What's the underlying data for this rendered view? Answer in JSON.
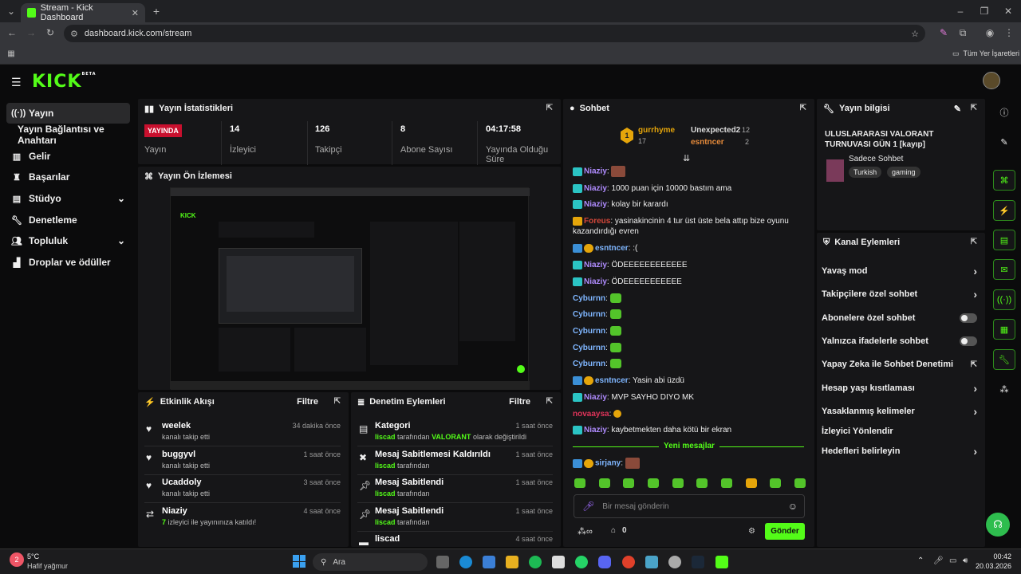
{
  "browser": {
    "tab_title": "Stream - Kick Dashboard",
    "url": "dashboard.kick.com/stream",
    "bookmarks_label": "Tüm Yer İşaretleri"
  },
  "app": {
    "logo": "KICK",
    "beta": "BETA"
  },
  "sidebar": {
    "items": [
      {
        "label": "Yayın",
        "icon": "broadcast-icon"
      },
      {
        "label": "Yayın Bağlantısı ve Anahtarı"
      },
      {
        "label": "Gelir",
        "icon": "bank-icon"
      },
      {
        "label": "Başarılar",
        "icon": "trophy-icon"
      },
      {
        "label": "Stüdyo",
        "icon": "studio-icon"
      },
      {
        "label": "Denetleme",
        "icon": "wrench-icon"
      },
      {
        "label": "Topluluk",
        "icon": "people-icon"
      },
      {
        "label": "Droplar ve ödüller",
        "icon": "gift-icon"
      }
    ]
  },
  "stats": {
    "title": "Yayın İstatistikleri",
    "live_badge": "YAYINDA",
    "live_label": "Yayın",
    "viewers": "14",
    "viewers_label": "İzleyici",
    "followers": "126",
    "followers_label": "Takipçi",
    "subs": "8",
    "subs_label": "Abone Sayısı",
    "uptime": "04:17:58",
    "uptime_label": "Yayında Olduğu Süre"
  },
  "preview": {
    "title": "Yayın Ön İzlemesi"
  },
  "activity": {
    "title": "Etkinlik Akışı",
    "filter": "Filtre",
    "rows": [
      {
        "name": "weelek",
        "sub": "kanalı takip etti",
        "time": "34 dakika önce"
      },
      {
        "name": "buggyvl",
        "sub": "kanalı takip etti",
        "time": "1 saat önce"
      },
      {
        "name": "Ucaddoly",
        "sub": "kanalı takip etti",
        "time": "3 saat önce"
      },
      {
        "name": "Niaziy",
        "sub_a": "7",
        "sub_b": "izleyici ile yayınınıza katıldı!",
        "time": "4 saat önce"
      }
    ]
  },
  "modlog": {
    "title": "Denetim Eylemleri",
    "filter": "Filtre",
    "rows": [
      {
        "title": "Kategori",
        "user": "liscad",
        "mid": "tarafından",
        "target": "VALORANT",
        "end": "olarak değiştirildi",
        "time": "1 saat önce"
      },
      {
        "title": "Mesaj Sabitlemesi Kaldırıldı",
        "user": "liscad",
        "mid": "tarafından",
        "time": "1 saat önce"
      },
      {
        "title": "Mesaj Sabitlendi",
        "user": "liscad",
        "mid": "tarafından",
        "time": "1 saat önce"
      },
      {
        "title": "Mesaj Sabitlendi",
        "user": "liscad",
        "mid": "tarafından",
        "time": "1 saat önce"
      },
      {
        "title": "liscad",
        "time": "4 saat önce"
      }
    ]
  },
  "chat": {
    "title": "Sohbet",
    "top": [
      {
        "name": "gurrhyme",
        "count": "17"
      },
      {
        "name": "Unexpected2",
        "count": "12"
      },
      {
        "name": "esntncer",
        "count": "2"
      }
    ],
    "top_rank": "1",
    "messages": [
      {
        "user": "Niaziy",
        "text": ""
      },
      {
        "user": "Niaziy",
        "text": "1000 puan için 10000 bastım ama"
      },
      {
        "user": "Niaziy",
        "text": "kolay bir karardı"
      },
      {
        "user": "Foreus",
        "text": "yasinakincinin 4 tur üst üste bela attıp bize oyunu kazandırdığı evren"
      },
      {
        "user": "esntncer",
        "text": ":("
      },
      {
        "user": "Niaziy",
        "text": "ÖDEEEEEEEEEEEE"
      },
      {
        "user": "Niaziy",
        "text": "ÖDEEEEEEEEEEE"
      },
      {
        "user": "Cyburnn",
        "text": ""
      },
      {
        "user": "Cyburnn",
        "text": ""
      },
      {
        "user": "Cyburnn",
        "text": ""
      },
      {
        "user": "Cyburnn",
        "text": ""
      },
      {
        "user": "Cyburnn",
        "text": ""
      },
      {
        "user": "esntncer",
        "text": "Yasin abi üzdü"
      },
      {
        "user": "Niaziy",
        "text": "MVP SAYHO DIYO MK"
      },
      {
        "user": "novaaysa",
        "text": ""
      },
      {
        "user": "Niaziy",
        "text": "kaybetmekten daha kötü bir ekran"
      }
    ],
    "new_messages": "Yeni mesajlar",
    "last_user": "sirjany",
    "input_placeholder": "Bir mesaj gönderin",
    "points": "0",
    "send": "Gönder"
  },
  "info": {
    "title": "Yayın bilgisi",
    "stream_title": "ULUSLARARASI VALORANT TURNUVASI GÜN 1 [kayıp]",
    "chat_mode": "Sadece Sohbet",
    "tags": [
      "Turkish",
      "gaming"
    ]
  },
  "actions": {
    "title": "Kanal Eylemleri",
    "items": [
      {
        "label": "Yavaş mod",
        "type": "arrow"
      },
      {
        "label": "Takipçilere özel sohbet",
        "type": "arrow"
      },
      {
        "label": "Abonelere özel sohbet",
        "type": "toggle"
      },
      {
        "label": "Yalnızca ifadelerle sohbet",
        "type": "toggle"
      },
      {
        "label": "Yapay Zeka ile Sohbet Denetimi",
        "type": "ext"
      },
      {
        "label": "Hesap yaşı kısıtlaması",
        "type": "arrow"
      },
      {
        "label": "Yasaklanmış kelimeler",
        "type": "arrow"
      },
      {
        "label": "İzleyici Yönlendir",
        "type": "none"
      },
      {
        "label": "Hedefleri belirleyin",
        "type": "arrow"
      }
    ]
  },
  "taskbar": {
    "weather_temp": "5°C",
    "weather_desc": "Hafif yağmur",
    "search": "Ara",
    "time": "00:42",
    "date": "20.03.2026",
    "notif_count": "2"
  },
  "colors": {
    "accent": "#53fc18",
    "niaziy": "#b08cff",
    "foreus": "#d4473a",
    "novaaysa": "#e0345a",
    "esntncer": "#7fb6ff"
  }
}
